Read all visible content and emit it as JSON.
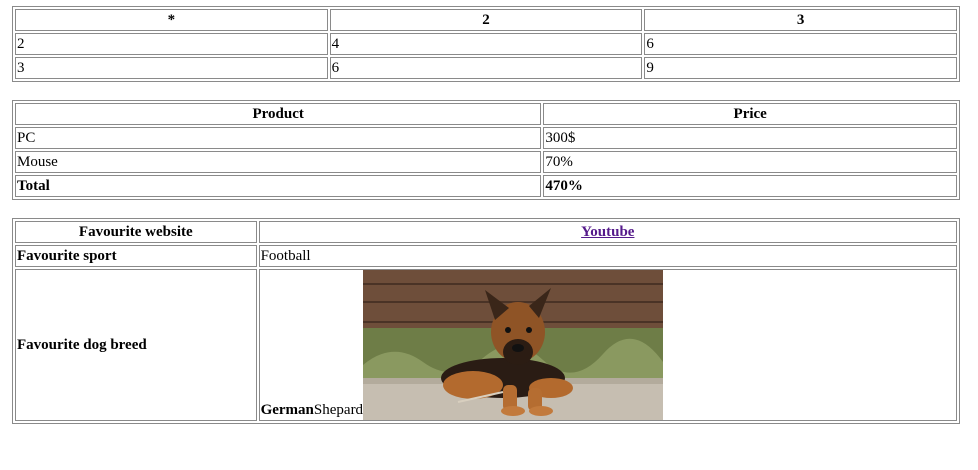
{
  "multiplication_table": {
    "header": [
      "*",
      "2",
      "3"
    ],
    "rows": [
      [
        "2",
        "4",
        "6"
      ],
      [
        "3",
        "6",
        "9"
      ]
    ]
  },
  "product_table": {
    "header": [
      "Product",
      "Price"
    ],
    "rows": [
      [
        "PC",
        "300$"
      ],
      [
        "Mouse",
        "70%"
      ]
    ],
    "total": [
      "Total",
      "470%"
    ]
  },
  "favourites_table": {
    "website_label": "Favourite website",
    "website_link": "Youtube",
    "sport_label": "Favourite sport",
    "sport_value": "Football",
    "dog_label": "Favourite dog breed",
    "dog_value_bold": "German",
    "dog_value_rest": "Shepard",
    "dog_image_icon": "german-shepherd-puppy-photo"
  },
  "colors": {
    "link_visited": "#551a8b",
    "border": "#8a8a8a"
  }
}
